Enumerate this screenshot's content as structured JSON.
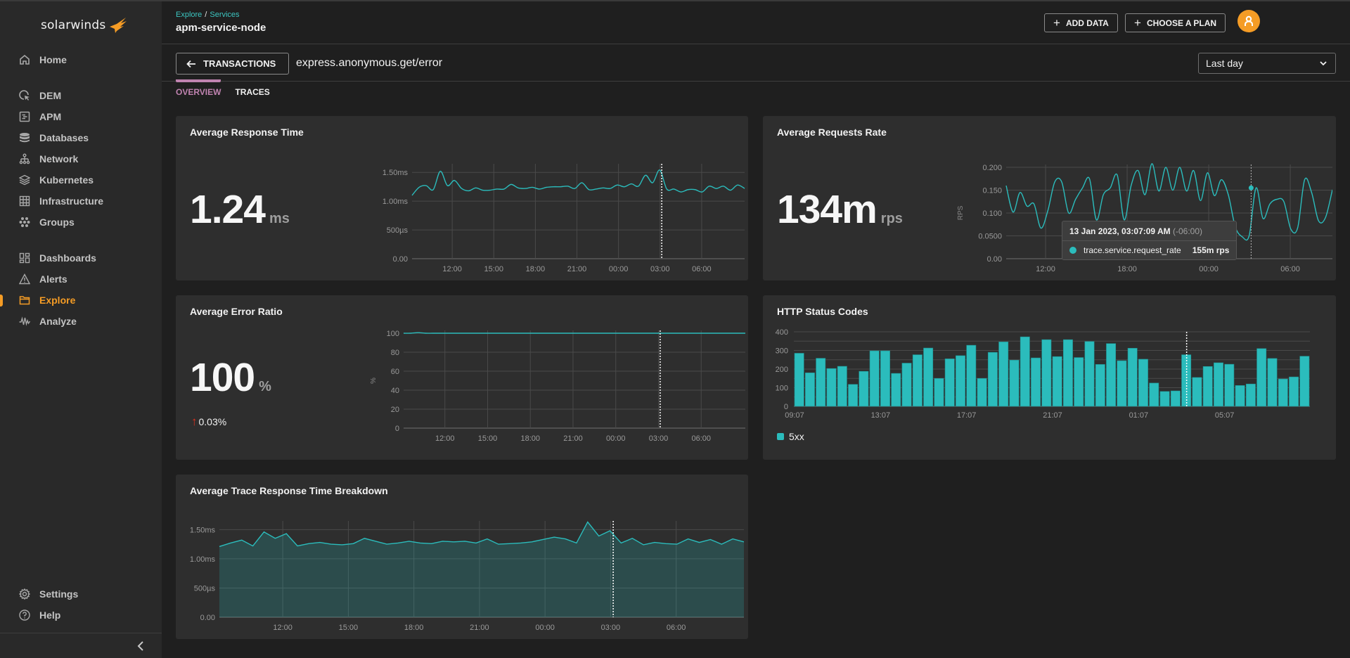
{
  "app": {
    "logo_text": "solarwinds",
    "brand_color": "#f59c25",
    "accent_color": "#2bbcbc"
  },
  "sidebar": {
    "groups": [
      [
        {
          "label": "Home",
          "icon": "home-icon"
        }
      ],
      [
        {
          "label": "DEM",
          "icon": "dem-cursor-icon"
        },
        {
          "label": "APM",
          "icon": "apm-document-icon"
        },
        {
          "label": "Databases",
          "icon": "database-icon"
        },
        {
          "label": "Network",
          "icon": "network-icon"
        },
        {
          "label": "Kubernetes",
          "icon": "layers-icon"
        },
        {
          "label": "Infrastructure",
          "icon": "grid-icon"
        },
        {
          "label": "Groups",
          "icon": "groups-icon"
        }
      ],
      [
        {
          "label": "Dashboards",
          "icon": "dashboards-icon"
        },
        {
          "label": "Alerts",
          "icon": "alert-triangle-icon"
        },
        {
          "label": "Explore",
          "icon": "folder-icon",
          "active": true
        },
        {
          "label": "Analyze",
          "icon": "pulse-icon"
        }
      ]
    ],
    "bottom": [
      {
        "label": "Settings",
        "icon": "gear-icon"
      },
      {
        "label": "Help",
        "icon": "help-icon"
      }
    ],
    "collapse_icon": "chevron-left-icon"
  },
  "header": {
    "breadcrumb": [
      "Explore",
      "Services"
    ],
    "breadcrumb_sep": "/",
    "title": "apm-service-node",
    "add_data_label": "ADD DATA",
    "choose_plan_label": "CHOOSE A PLAN",
    "avatar_icon": "user-icon"
  },
  "subheader": {
    "back_label": "TRANSACTIONS",
    "transaction_name": "express.anonymous.get/error",
    "time_range": "Last day"
  },
  "tabs": [
    {
      "label": "OVERVIEW",
      "active": true
    },
    {
      "label": "TRACES",
      "active": false
    }
  ],
  "cards": {
    "response_time": {
      "title": "Average Response Time",
      "value": "1.24",
      "unit": "ms"
    },
    "requests_rate": {
      "title": "Average Requests Rate",
      "value": "134m",
      "unit": "rps",
      "tooltip": {
        "time": "13 Jan 2023, 03:07:09 AM",
        "tz": "(-06:00)",
        "metric": "trace.service.request_rate",
        "value": "155m rps"
      }
    },
    "error_ratio": {
      "title": "Average Error Ratio",
      "value": "100",
      "unit": "%",
      "delta_arrow": "↑",
      "delta": "0.03%"
    },
    "status_codes": {
      "title": "HTTP Status Codes",
      "legend": "5xx"
    },
    "breakdown": {
      "title": "Average Trace Response Time Breakdown"
    }
  },
  "chart_data": [
    {
      "id": "response_time",
      "type": "line",
      "title": "Average Response Time",
      "x_start_hour": 9.1,
      "x_end_hour": 33.1,
      "xticks": [
        "12:00",
        "15:00",
        "18:00",
        "21:00",
        "00:00",
        "03:00",
        "06:00"
      ],
      "xtick_hours": [
        12,
        15,
        18,
        21,
        24,
        27,
        30
      ],
      "yticks": [
        "0.00",
        "500µs",
        "1.00ms",
        "1.50ms"
      ],
      "ytick_values": [
        0,
        0.5,
        1.0,
        1.5
      ],
      "ylim": [
        0,
        1.6
      ],
      "ylabel": "",
      "cursor_hour": 27.12,
      "values": [
        1.1,
        1.24,
        1.27,
        1.2,
        1.52,
        1.27,
        1.36,
        1.22,
        1.18,
        1.23,
        1.19,
        1.19,
        1.21,
        1.21,
        1.29,
        1.23,
        1.22,
        1.24,
        1.21,
        1.24,
        1.25,
        1.25,
        1.26,
        1.22,
        1.32,
        1.2,
        1.21,
        1.23,
        1.22,
        1.28,
        1.25,
        1.3,
        1.26,
        1.45,
        1.32,
        1.54,
        1.21,
        1.21,
        1.16,
        1.2,
        1.2,
        1.16,
        1.26,
        1.22,
        1.26,
        1.19,
        1.28,
        1.22
      ]
    },
    {
      "id": "requests_rate",
      "type": "line",
      "title": "Average Requests Rate",
      "ylabel": "RPS",
      "x_start_hour": 9.1,
      "x_end_hour": 33.1,
      "xticks": [
        "12:00",
        "18:00",
        "00:00",
        "06:00"
      ],
      "xtick_hours": [
        12,
        18,
        24,
        30
      ],
      "yticks": [
        "0.00",
        "0.0500",
        "0.100",
        "0.150",
        "0.200"
      ],
      "ytick_values": [
        0,
        0.05,
        0.1,
        0.15,
        0.2
      ],
      "ylim": [
        0,
        0.2
      ],
      "cursor_hour": 27.12,
      "cursor_value": 0.155,
      "values": [
        0.16,
        0.102,
        0.145,
        0.115,
        0.12,
        0.067,
        0.105,
        0.168,
        0.168,
        0.1,
        0.13,
        0.155,
        0.175,
        0.085,
        0.14,
        0.155,
        0.183,
        0.085,
        0.16,
        0.193,
        0.14,
        0.208,
        0.148,
        0.2,
        0.15,
        0.2,
        0.148,
        0.193,
        0.127,
        0.188,
        0.138,
        0.173,
        0.14,
        0.07,
        0.048,
        0.05,
        0.155,
        0.088,
        0.12,
        0.13,
        0.125,
        0.065,
        0.068,
        0.173,
        0.145,
        0.083,
        0.09,
        0.151
      ]
    },
    {
      "id": "error_ratio",
      "type": "line",
      "title": "Average Error Ratio",
      "ylabel": "%",
      "x_start_hour": 9.1,
      "x_end_hour": 33.1,
      "xticks": [
        "12:00",
        "15:00",
        "18:00",
        "21:00",
        "00:00",
        "03:00",
        "06:00"
      ],
      "xtick_hours": [
        12,
        15,
        18,
        21,
        24,
        27,
        30
      ],
      "yticks": [
        "0",
        "20",
        "40",
        "60",
        "80",
        "100"
      ],
      "ytick_values": [
        0,
        20,
        40,
        60,
        80,
        100
      ],
      "ylim": [
        0,
        100
      ],
      "cursor_hour": 27.12,
      "values": [
        100,
        100,
        100.6,
        100,
        100,
        100,
        100,
        100,
        100,
        100,
        100,
        100,
        100,
        100,
        100,
        100,
        100,
        100,
        100,
        100,
        100,
        100,
        100,
        100,
        100,
        100,
        100,
        100,
        100,
        100,
        100,
        100,
        100,
        100,
        100,
        100,
        100,
        100,
        100,
        100,
        100,
        100,
        100,
        100,
        100,
        100,
        100,
        100
      ]
    },
    {
      "id": "status_codes",
      "type": "bar",
      "title": "HTTP Status Codes",
      "series": [
        {
          "name": "5xx",
          "values": [
            285,
            180,
            258,
            203,
            215,
            118,
            188,
            298,
            298,
            177,
            232,
            277,
            313,
            150,
            255,
            272,
            328,
            150,
            290,
            346,
            248,
            373,
            260,
            358,
            267,
            358,
            262,
            348,
            225,
            337,
            245,
            312,
            253,
            125,
            80,
            83,
            277,
            155,
            214,
            234,
            226,
            112,
            120,
            310,
            257,
            147,
            158,
            269
          ]
        }
      ],
      "xticks": [
        "09:07",
        "13:07",
        "17:07",
        "21:07",
        "01:07",
        "05:07"
      ],
      "xtick_bar_index": [
        0,
        8,
        16,
        24,
        32,
        40
      ],
      "yticks": [
        "0",
        "100",
        "200",
        "300",
        "400"
      ],
      "ytick_values": [
        0,
        100,
        200,
        300,
        400
      ],
      "ylim": [
        0,
        400
      ],
      "cursor_bar_index": 36,
      "legend": "bottom-left"
    },
    {
      "id": "breakdown",
      "type": "area",
      "title": "Average Trace Response Time Breakdown",
      "x_start_hour": 9.1,
      "x_end_hour": 33.1,
      "xticks": [
        "12:00",
        "15:00",
        "18:00",
        "21:00",
        "00:00",
        "03:00",
        "06:00"
      ],
      "xtick_hours": [
        12,
        15,
        18,
        21,
        24,
        27,
        30
      ],
      "yticks": [
        "0.00",
        "500µs",
        "1.00ms",
        "1.50ms"
      ],
      "ytick_values": [
        0,
        0.5,
        1.0,
        1.5
      ],
      "ylim": [
        0,
        1.6
      ],
      "cursor_hour": 27.12,
      "values": [
        1.21,
        1.27,
        1.32,
        1.22,
        1.46,
        1.35,
        1.43,
        1.22,
        1.26,
        1.28,
        1.25,
        1.24,
        1.26,
        1.35,
        1.3,
        1.25,
        1.27,
        1.3,
        1.27,
        1.26,
        1.3,
        1.29,
        1.3,
        1.27,
        1.34,
        1.25,
        1.26,
        1.27,
        1.29,
        1.33,
        1.37,
        1.34,
        1.27,
        1.63,
        1.39,
        1.48,
        1.27,
        1.35,
        1.24,
        1.28,
        1.26,
        1.25,
        1.34,
        1.28,
        1.33,
        1.25,
        1.34,
        1.29
      ]
    }
  ]
}
